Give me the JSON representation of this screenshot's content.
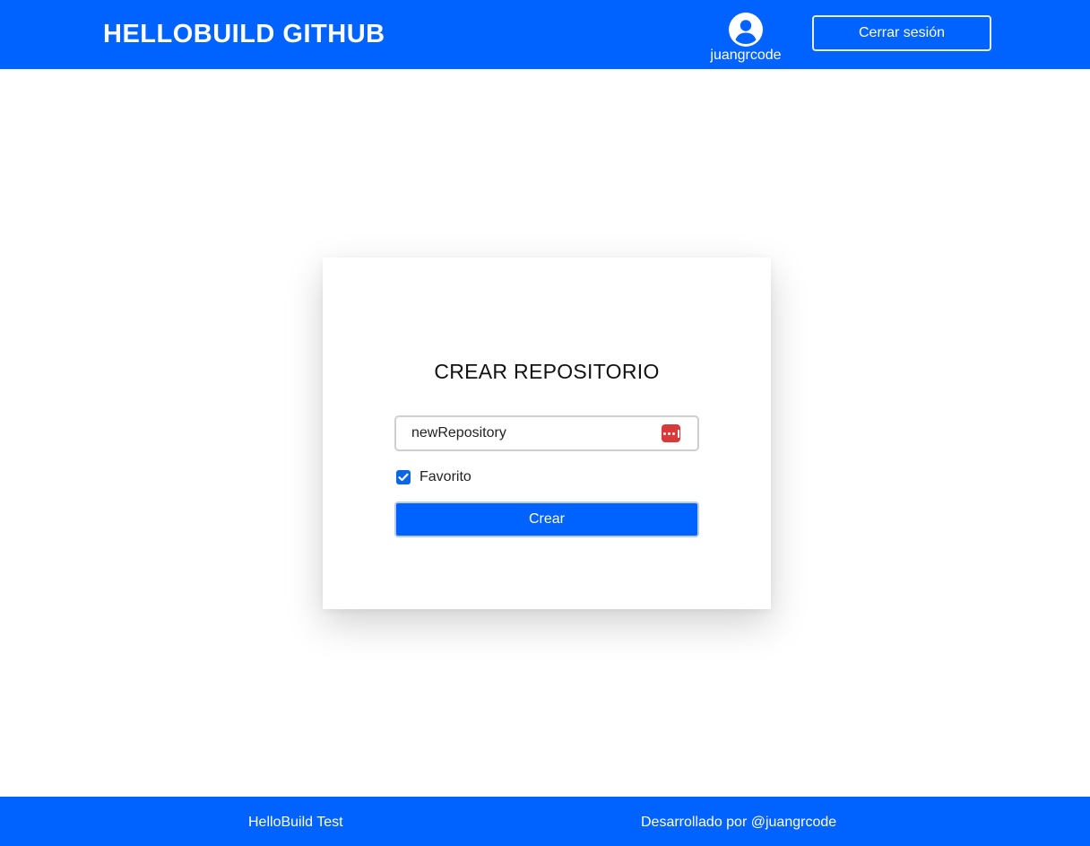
{
  "header": {
    "brand": "HELLOBUILD GITHUB",
    "user": {
      "icon": "user-circle-icon",
      "username": "juangrcode"
    },
    "logout_label": "Cerrar sesión"
  },
  "form": {
    "title": "CREAR REPOSITORIO",
    "repo_name": {
      "value": "newRepository",
      "icon": "password-manager-icon"
    },
    "favorite": {
      "label": "Favorito",
      "checked": true
    },
    "submit_label": "Crear"
  },
  "footer": {
    "left": "HelloBuild Test",
    "right": "Desarrollado por @juangrcode"
  },
  "colors": {
    "primary": "#0063ff",
    "checkbox": "#0a66e4",
    "password_icon": "#d83a3a"
  }
}
